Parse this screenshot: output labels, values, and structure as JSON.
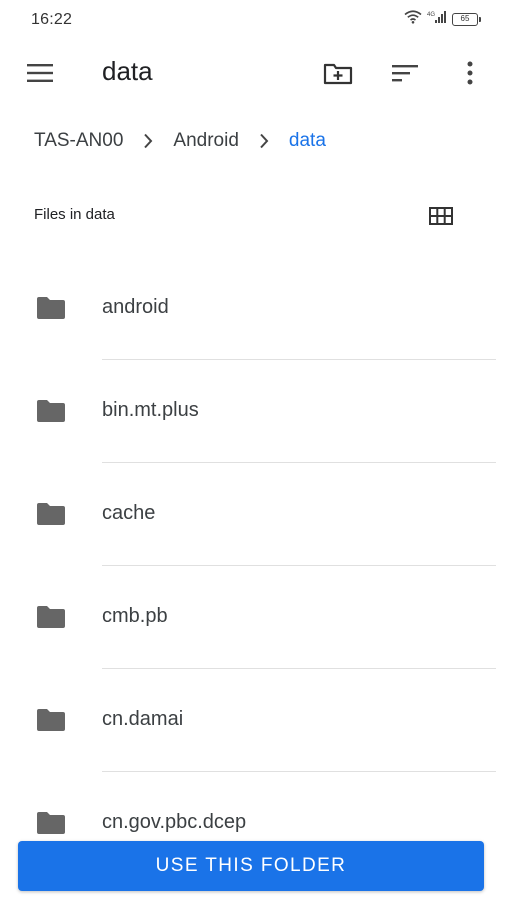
{
  "status_bar": {
    "time": "16:22",
    "battery": "65",
    "icons": [
      "wifi-icon",
      "signal-icon",
      "battery-icon"
    ]
  },
  "app_bar": {
    "title": "data",
    "icons": [
      "menu-icon",
      "new-folder-icon",
      "sort-icon",
      "more-vert-icon"
    ]
  },
  "breadcrumb": {
    "items": [
      {
        "label": "TAS-AN00"
      },
      {
        "label": "Android"
      },
      {
        "label": "data"
      }
    ],
    "separator_icon": "chevron-right-icon"
  },
  "files_header": {
    "label": "Files in data",
    "view_toggle_icon": "grid-view-icon"
  },
  "files": [
    {
      "name": "android",
      "icon": "folder-icon"
    },
    {
      "name": "bin.mt.plus",
      "icon": "folder-icon"
    },
    {
      "name": "cache",
      "icon": "folder-icon"
    },
    {
      "name": "cmb.pb",
      "icon": "folder-icon"
    },
    {
      "name": "cn.damai",
      "icon": "folder-icon"
    },
    {
      "name": "cn.gov.pbc.dcep",
      "icon": "folder-icon"
    }
  ],
  "primary_action": {
    "label": "USE THIS FOLDER"
  },
  "colors": {
    "accent": "#1a73e8",
    "icon_gray": "#5f6368",
    "text": "#3c4043",
    "divider": "#e0e0e0"
  }
}
